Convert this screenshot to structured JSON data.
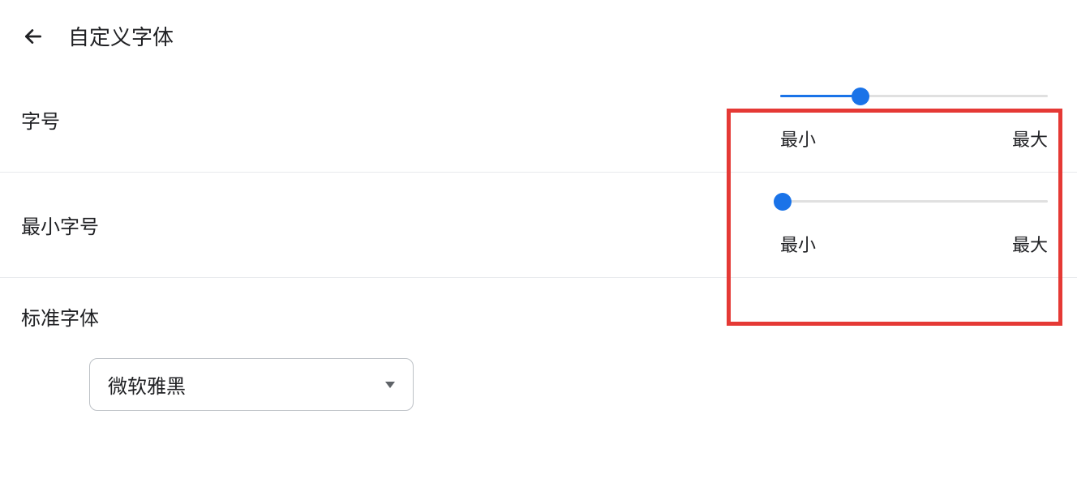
{
  "header": {
    "title": "自定义字体"
  },
  "fontSize": {
    "label": "字号",
    "minLabel": "最小",
    "maxLabel": "最大",
    "valuePercent": 30
  },
  "minFontSize": {
    "label": "最小字号",
    "minLabel": "最小",
    "maxLabel": "最大",
    "valuePercent": 1
  },
  "standardFont": {
    "label": "标准字体",
    "selected": "微软雅黑"
  }
}
